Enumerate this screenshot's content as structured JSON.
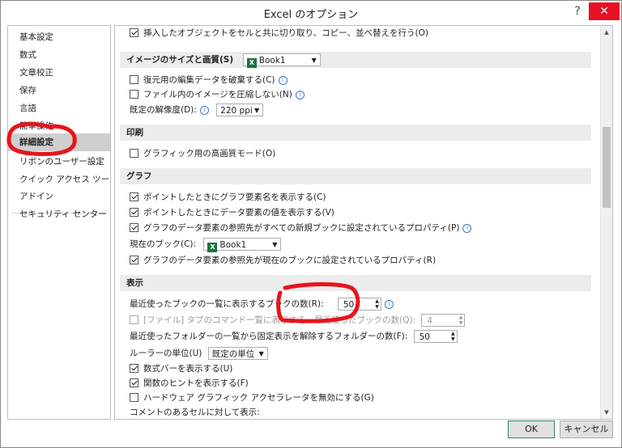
{
  "window": {
    "title": "Excel のオプション",
    "help_label": "?",
    "close_label": "✕"
  },
  "sidebar": {
    "items": [
      {
        "label": "基本設定"
      },
      {
        "label": "数式"
      },
      {
        "label": "文章校正"
      },
      {
        "label": "保存"
      },
      {
        "label": "言語"
      },
      {
        "label": "簡単操作"
      },
      {
        "label": "詳細設定"
      },
      {
        "label": "リボンのユーザー設定"
      },
      {
        "label": "クイック アクセス ツール バー"
      },
      {
        "label": "アドイン"
      },
      {
        "label": "セキュリティ センター"
      }
    ]
  },
  "content": {
    "top_option": {
      "label": "挿入したオブジェクトをセルと共に切り取り、コピー、並べ替えを行う(O)",
      "checked": true
    },
    "image_section": {
      "title": "イメージのサイズと画質(S)",
      "book": "Book1",
      "discard_edit": {
        "label": "復元用の編集データを破棄する(C)",
        "checked": false
      },
      "no_compress": {
        "label": "ファイル内のイメージを圧縮しない(N)",
        "checked": false
      },
      "resolution_label": "既定の解像度(D):",
      "resolution_value": "220 ppi"
    },
    "print_section": {
      "title": "印刷",
      "high_quality": {
        "label": "グラフィック用の高画質モード(O)",
        "checked": false
      }
    },
    "chart_section": {
      "title": "グラフ",
      "show_element_names": {
        "label": "ポイントしたときにグラフ要素名を表示する(C)",
        "checked": true
      },
      "show_data_values": {
        "label": "ポイントしたときにデータ要素の値を表示する(V)",
        "checked": true
      },
      "props_all_new": {
        "label": "グラフのデータ要素の参照先がすべての新規ブックに設定されているプロパティ(P)",
        "checked": true
      },
      "current_book_label": "現在のブック(C):",
      "current_book_value": "Book1",
      "props_current": {
        "label": "グラフのデータ要素の参照先が現在のブックに設定されているプロパティ(R)",
        "checked": true
      }
    },
    "display_section": {
      "title": "表示",
      "recent_books_label": "最近使ったブックの一覧に表示するブックの数(R):",
      "recent_books_value": "50",
      "file_tab_label": "[ファイル] タブのコマンド一覧に表示する、最近使ったブックの数(Q):",
      "file_tab_value": "4",
      "recent_folders_label": "最近使ったフォルダーの一覧から固定表示を解除するフォルダーの数(F):",
      "recent_folders_value": "50",
      "ruler_label": "ルーラーの単位(U)",
      "ruler_value": "既定の単位",
      "formula_bar": {
        "label": "数式バーを表示する(U)",
        "checked": true
      },
      "function_tips": {
        "label": "関数のヒントを表示する(F)",
        "checked": true
      },
      "hw_accel": {
        "label": "ハードウェア グラフィック アクセラレータを無効にする(G)",
        "checked": false
      },
      "comments_label": "コメントのあるセルに対して表示:"
    }
  },
  "footer": {
    "ok_label": "OK",
    "cancel_label": "キャンセル"
  },
  "colors": {
    "annotation_red": "#e8141b",
    "excel_green": "#1e7145",
    "close_red": "#e81123"
  }
}
